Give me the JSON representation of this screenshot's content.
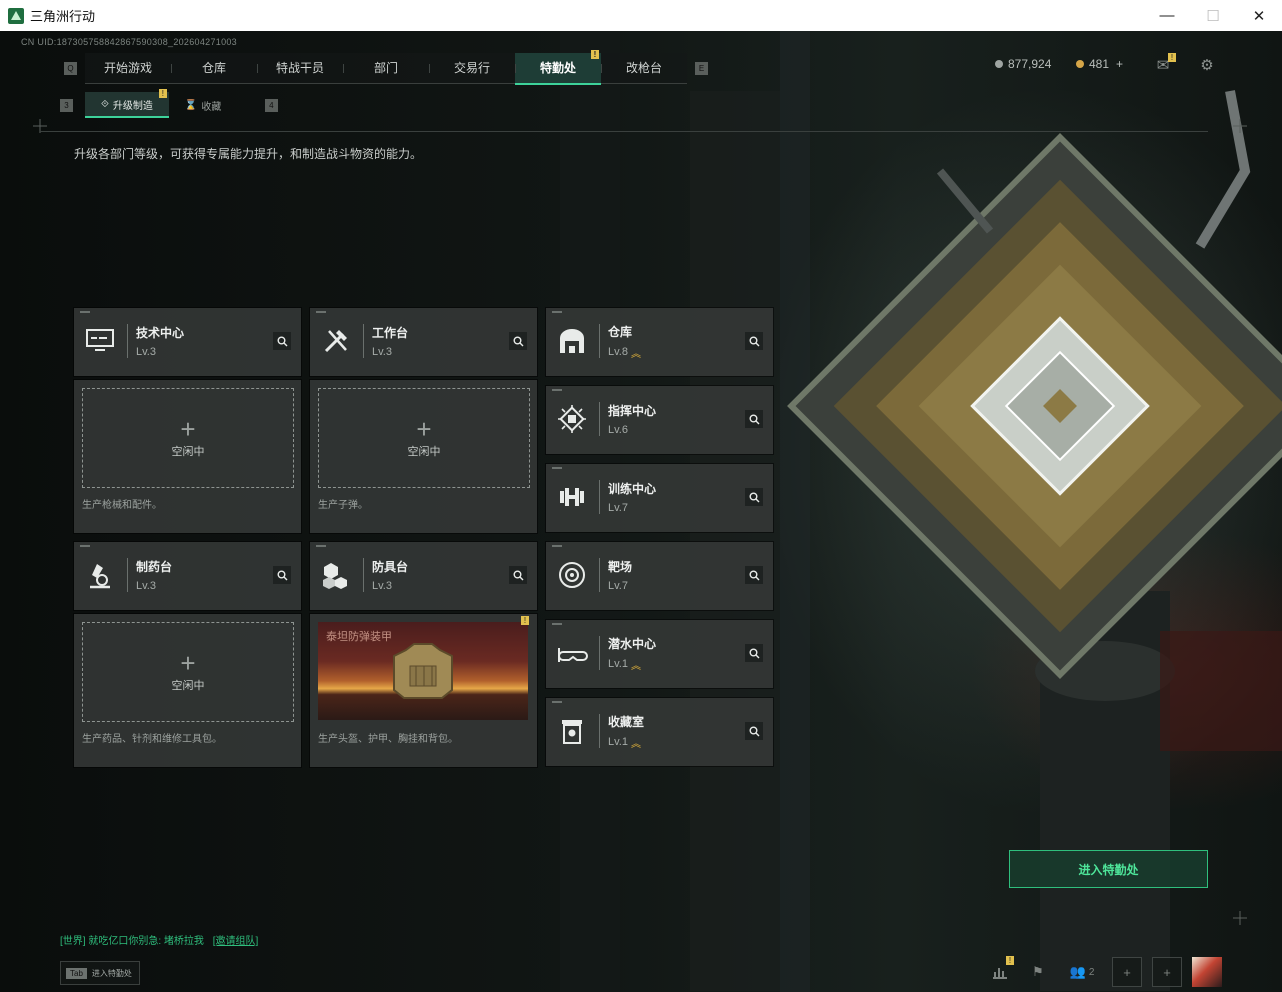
{
  "window": {
    "title": "三角洲行动",
    "minimize": "—",
    "maximize": "☐",
    "close": "✕"
  },
  "uid": "CN UID:187305758842867590308_202604271003",
  "nav": {
    "left_key": "Q",
    "right_key": "E",
    "tabs": [
      {
        "label": "开始游戏"
      },
      {
        "label": "仓库"
      },
      {
        "label": "特战干员"
      },
      {
        "label": "部门"
      },
      {
        "label": "交易行"
      },
      {
        "label": "特勤处",
        "active": true,
        "badge": "!"
      },
      {
        "label": "改枪台"
      }
    ]
  },
  "subnav": {
    "left_key": "3",
    "right_key": "4",
    "tabs": [
      {
        "label": "升级制造",
        "active": true,
        "badge": "!"
      },
      {
        "label": "收藏"
      }
    ]
  },
  "currency": {
    "silver": "877,924",
    "gold": "481",
    "gold_add": "+"
  },
  "colors": {
    "accent": "#3dd29a",
    "badge": "#e2c14e",
    "upgrade": "#e3b43b"
  },
  "description": "升级各部门等级，可获得专属能力提升，和制造战斗物资的能力。",
  "production_departments": [
    {
      "name": "技术中心",
      "level": "Lv.3",
      "icon": "monitor-icon",
      "slot_state": "空闲中",
      "desc": "生产枪械和配件。"
    },
    {
      "name": "工作台",
      "level": "Lv.3",
      "icon": "tools-icon",
      "slot_state": "空闲中",
      "desc": "生产子弹。"
    },
    {
      "name": "制药台",
      "level": "Lv.3",
      "icon": "microscope-icon",
      "slot_state": "空闲中",
      "desc": "生产药品、针剂和维修工具包。"
    },
    {
      "name": "防具台",
      "level": "Lv.3",
      "icon": "blocks-icon",
      "item_name": "泰坦防弹装甲",
      "item_badge": "!",
      "desc": "生产头盔、护甲、胸挂和背包。"
    }
  ],
  "other_departments": [
    {
      "name": "仓库",
      "level": "Lv.8",
      "upgradeable": true,
      "icon": "warehouse-icon"
    },
    {
      "name": "指挥中心",
      "level": "Lv.6",
      "upgradeable": false,
      "icon": "command-icon"
    },
    {
      "name": "训练中心",
      "level": "Lv.7",
      "upgradeable": false,
      "icon": "dumbbell-icon"
    },
    {
      "name": "靶场",
      "level": "Lv.7",
      "upgradeable": false,
      "icon": "target-icon"
    },
    {
      "name": "潜水中心",
      "level": "Lv.1",
      "upgradeable": true,
      "icon": "diving-mask-icon"
    },
    {
      "name": "收藏室",
      "level": "Lv.1",
      "upgradeable": true,
      "icon": "collection-icon"
    }
  ],
  "enter_button": "进入特勤处",
  "chat": {
    "channel": "[世界]",
    "message": "就吃亿口你别急: 堵桥拉我",
    "link": "[邀请组队]"
  },
  "tab_hint": {
    "key": "Tab",
    "label": "进入特勤处"
  },
  "bottom_bar": {
    "friends_count": "2",
    "stats_badge": "!"
  }
}
